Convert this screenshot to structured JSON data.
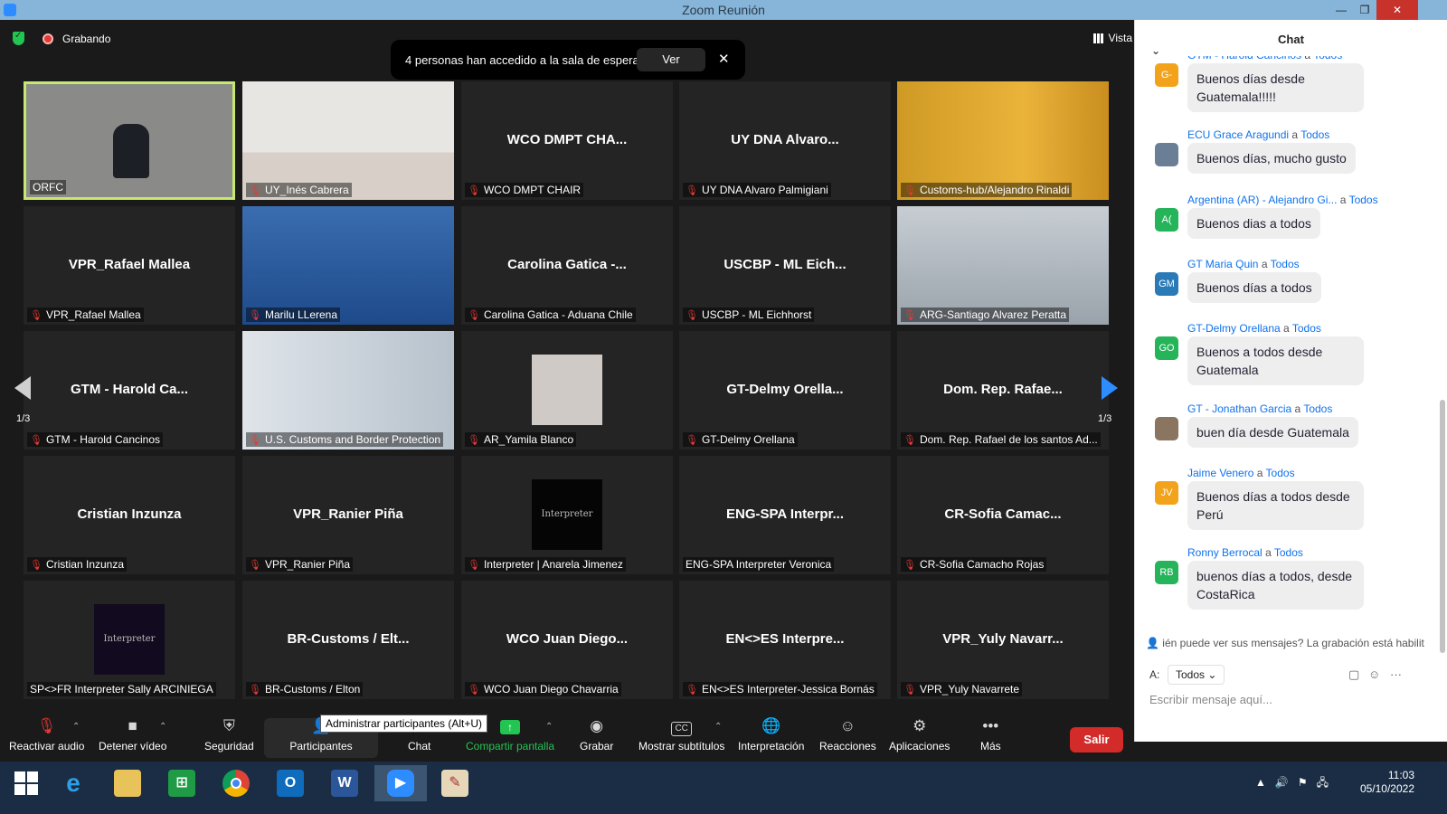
{
  "window": {
    "title": "Zoom Reunión"
  },
  "top": {
    "recording": "Grabando",
    "view": "Vista"
  },
  "banner": {
    "message": "4 personas han accedido a la sala de espera",
    "button": "Ver"
  },
  "pager": {
    "left": "1/3",
    "right": "1/3"
  },
  "tiles": [
    {
      "big": "",
      "label": "ORFC",
      "muted": false
    },
    {
      "big": "",
      "label": "UY_Inés Cabrera",
      "muted": true
    },
    {
      "big": "WCO DMPT CHA...",
      "label": "WCO DMPT CHAIR",
      "muted": true
    },
    {
      "big": "UY DNA Alvaro...",
      "label": "UY DNA Alvaro Palmigiani",
      "muted": true
    },
    {
      "big": "",
      "label": "Customs-hub/Alejandro Rinaldi",
      "muted": true
    },
    {
      "big": "VPR_Rafael Mallea",
      "label": "VPR_Rafael Mallea",
      "muted": true
    },
    {
      "big": "",
      "label": "Marilu LLerena",
      "muted": true
    },
    {
      "big": "Carolina Gatica -...",
      "label": "Carolina Gatica - Aduana Chile",
      "muted": true
    },
    {
      "big": "USCBP - ML Eich...",
      "label": "USCBP - ML Eichhorst",
      "muted": true
    },
    {
      "big": "",
      "label": "ARG-Santiago Alvarez Peratta",
      "muted": true
    },
    {
      "big": "GTM - Harold Ca...",
      "label": "GTM - Harold Cancinos",
      "muted": true
    },
    {
      "big": "",
      "label": "U.S. Customs and Border Protection",
      "muted": true
    },
    {
      "big": "",
      "label": "AR_Yamila Blanco",
      "muted": true
    },
    {
      "big": "GT-Delmy Orella...",
      "label": "GT-Delmy Orellana",
      "muted": true
    },
    {
      "big": "Dom. Rep. Rafae...",
      "label": "Dom. Rep. Rafael de los santos Ad...",
      "muted": true
    },
    {
      "big": "Cristian Inzunza",
      "label": "Cristian Inzunza",
      "muted": true
    },
    {
      "big": "VPR_Ranier Piña",
      "label": "VPR_Ranier Piña",
      "muted": true
    },
    {
      "big": "",
      "label": "Interpreter | Anarela Jimenez",
      "muted": true
    },
    {
      "big": "ENG-SPA Interpr...",
      "label": "ENG-SPA Interpreter Veronica",
      "muted": false
    },
    {
      "big": "CR-Sofia Camac...",
      "label": "CR-Sofia Camacho Rojas",
      "muted": true
    },
    {
      "big": "",
      "label": "SP<>FR Interpreter Sally ARCINIEGA",
      "muted": false
    },
    {
      "big": "BR-Customs / Elt...",
      "label": "BR-Customs / Elton",
      "muted": true
    },
    {
      "big": "WCO Juan Diego...",
      "label": "WCO Juan Diego Chavarria",
      "muted": true
    },
    {
      "big": "EN<>ES Interpre...",
      "label": "EN<>ES Interpreter-Jessica Bornás",
      "muted": true
    },
    {
      "big": "VPR_Yuly Navarr...",
      "label": "VPR_Yuly Navarrete",
      "muted": true
    }
  ],
  "logo_text": {
    "interpreter1": "Interpreter",
    "interpreter2": "Interpreter"
  },
  "toolbar": {
    "audio": "Reactivar audio",
    "video": "Detener vídeo",
    "security": "Seguridad",
    "participants": "Participantes",
    "chat": "Chat",
    "share": "Compartir pantalla",
    "record": "Grabar",
    "cc": "Mostrar subtítulos",
    "interp": "Interpretación",
    "reactions": "Reacciones",
    "apps": "Aplicaciones",
    "more": "Más",
    "leave": "Salir",
    "tooltip": "Administrar participantes (Alt+U)",
    "cc_badge": "CC"
  },
  "chat": {
    "title": "Chat",
    "messages": [
      {
        "from": "GTM - Harold Cancinos",
        "to": "Todos",
        "avatar": "G-",
        "color": "#f2a31b",
        "text": "Buenos días desde Guatemala!!!!!"
      },
      {
        "from": "ECU Grace Aragundi",
        "to": "Todos",
        "avatar": "",
        "color": "#6a7f96",
        "text": "Buenos días, mucho gusto"
      },
      {
        "from": "Argentina (AR) - Alejandro Gi...",
        "to": "Todos",
        "avatar": "A(",
        "color": "#25b45a",
        "text": "Buenos dias a todos"
      },
      {
        "from": "GT Maria Quin",
        "to": "Todos",
        "avatar": "GM",
        "color": "#2a7ab8",
        "text": "Buenos días a todos"
      },
      {
        "from": "GT-Delmy Orellana",
        "to": "Todos",
        "avatar": "GO",
        "color": "#25b45a",
        "text": "Buenos a todos desde Guatemala"
      },
      {
        "from": "GT - Jonathan Garcia",
        "to": "Todos",
        "avatar": "",
        "color": "#8a7560",
        "text": "buen día desde Guatemala"
      },
      {
        "from": "Jaime Venero",
        "to": "Todos",
        "avatar": "JV",
        "color": "#f2a31b",
        "text": "Buenos días a todos desde Perú"
      },
      {
        "from": "Ronny Berrocal",
        "to": "Todos",
        "avatar": "RB",
        "color": "#25b45a",
        "text": "buenos días a todos, desde CostaRica"
      }
    ],
    "to_word": "a",
    "notice": "ién puede ver sus mensajes? La grabación está habilit",
    "to_label": "A:",
    "recipient": "Todos",
    "placeholder": "Escribir mensaje aquí..."
  },
  "taskbar": {
    "time": "11:03",
    "date": "05/10/2022"
  }
}
